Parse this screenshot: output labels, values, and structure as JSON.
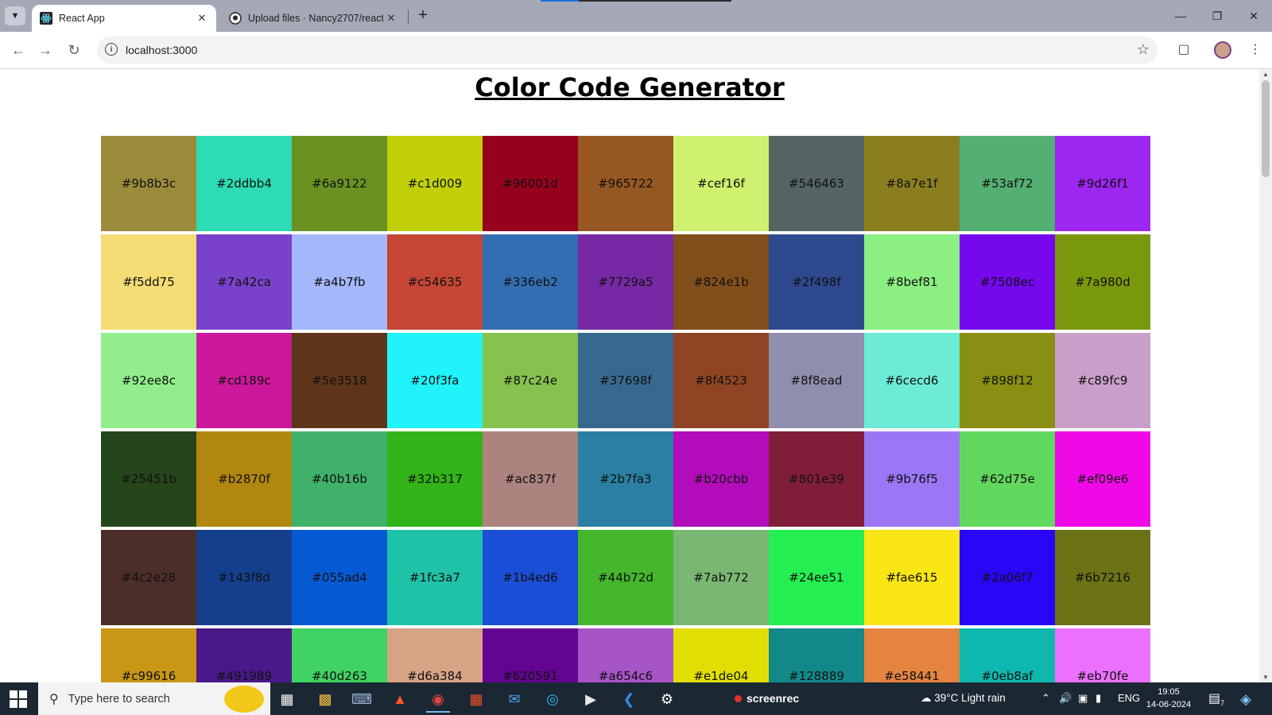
{
  "browser": {
    "tabs": [
      {
        "title": "React App",
        "icon": "react-icon",
        "active": true
      },
      {
        "title": "Upload files · Nancy2707/react-",
        "icon": "github-icon",
        "active": false
      }
    ],
    "address": "localhost:3000"
  },
  "page": {
    "title": "Color Code Generator",
    "rows": [
      [
        "#9b8b3c",
        "#2ddbb4",
        "#6a9122",
        "#c1d009",
        "#96001d",
        "#965722",
        "#cef16f",
        "#546463",
        "#8a7e1f",
        "#53af72",
        "#9d26f1"
      ],
      [
        "#f5dd75",
        "#7a42ca",
        "#a4b7fb",
        "#c54635",
        "#336eb2",
        "#7729a5",
        "#824e1b",
        "#2f498f",
        "#8bef81",
        "#7508ec",
        "#7a980d"
      ],
      [
        "#92ee8c",
        "#cd189c",
        "#5e3518",
        "#20f3fa",
        "#87c24e",
        "#37698f",
        "#8f4523",
        "#8f8ead",
        "#6cecd6",
        "#898f12",
        "#c89fc9"
      ],
      [
        "#25451b",
        "#b2870f",
        "#40b16b",
        "#32b317",
        "#ac837f",
        "#2b7fa3",
        "#b20cbb",
        "#801e39",
        "#9b76f5",
        "#62d75e",
        "#ef09e6"
      ],
      [
        "#4c2e28",
        "#143f8d",
        "#055ad4",
        "#1fc3a7",
        "#1b4ed6",
        "#44b72d",
        "#7ab772",
        "#24ee51",
        "#fae615",
        "#2a06f7",
        "#6b7216"
      ],
      [
        "#c99616",
        "#491989",
        "#40d263",
        "#d6a384",
        "#620591",
        "#a654c6",
        "#e1de04",
        "#128889",
        "#e58441",
        "#0eb8af",
        "#eb70fe"
      ]
    ]
  },
  "taskbar": {
    "search_placeholder": "Type here to search",
    "screenrec": "screenrec",
    "weather": "39°C  Light rain",
    "language": "ENG",
    "time": "19:05",
    "date": "14-06-2024",
    "notification_count": "7"
  }
}
